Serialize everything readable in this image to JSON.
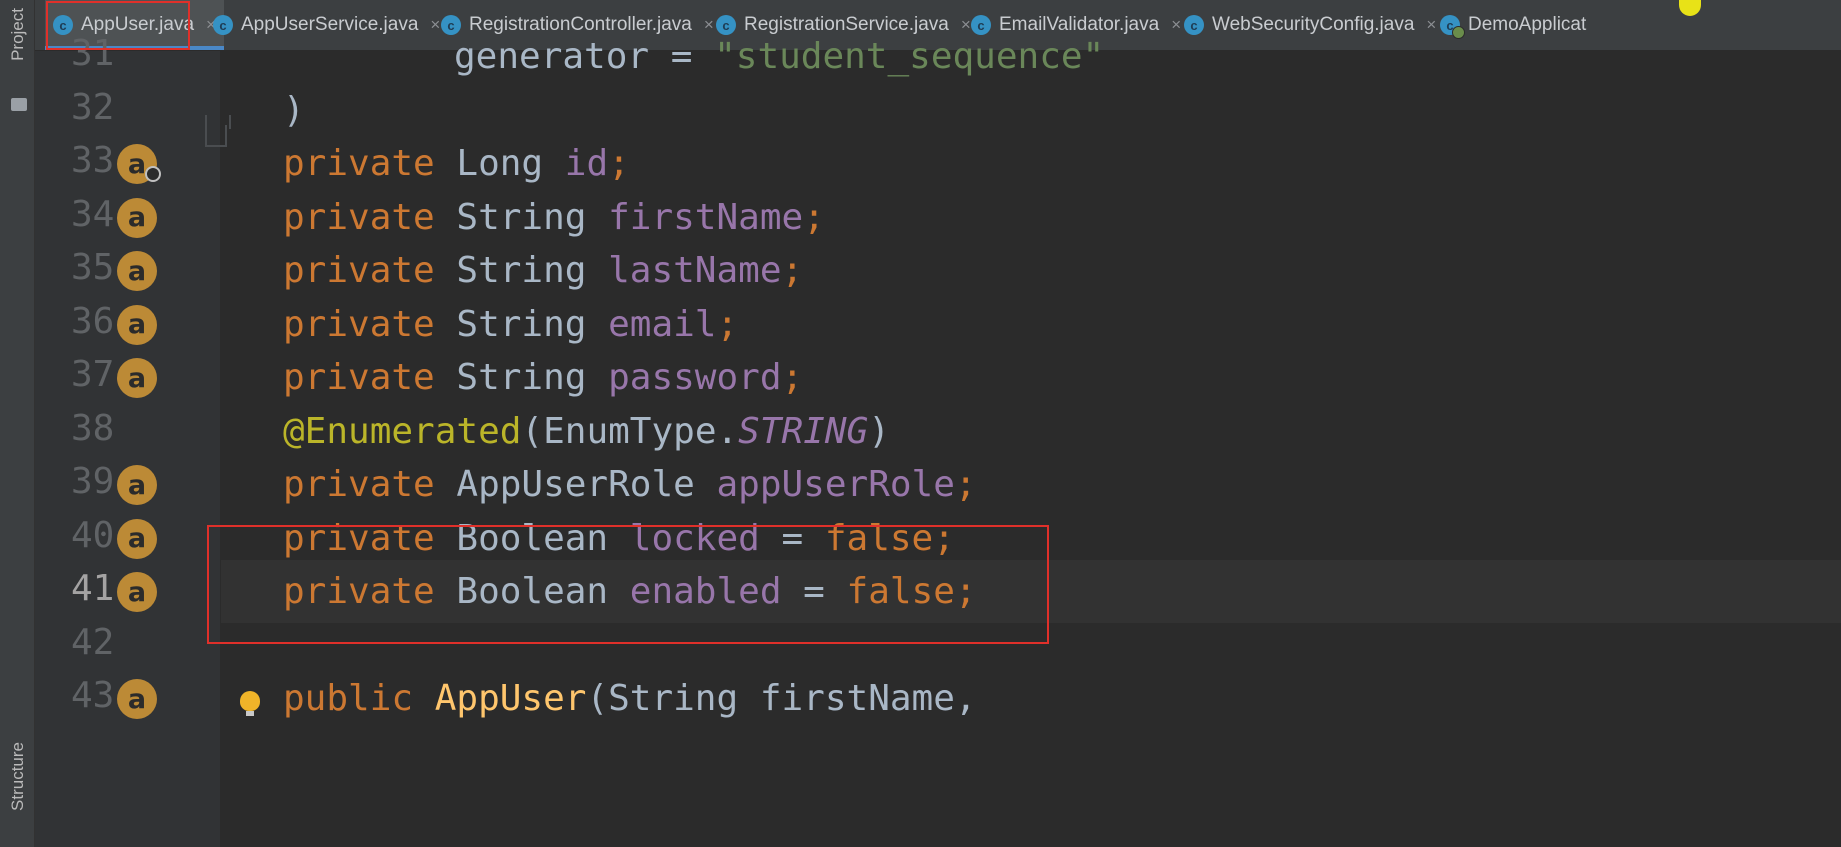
{
  "tool_windows": {
    "project_label": "Project",
    "structure_label": "Structure"
  },
  "tabs": [
    {
      "label": "AppUser.java",
      "active": true
    },
    {
      "label": "AppUserService.java",
      "active": false
    },
    {
      "label": "RegistrationController.java",
      "active": false
    },
    {
      "label": "RegistrationService.java",
      "active": false
    },
    {
      "label": "EmailValidator.java",
      "active": false
    },
    {
      "label": "WebSecurityConfig.java",
      "active": false
    },
    {
      "label": "DemoApplicat",
      "active": false
    }
  ],
  "tab_close_glyph": "×",
  "class_icon_glyph": "c",
  "field_icon_glyph": "a",
  "current_line": "41",
  "code_lines": [
    {
      "number": "31",
      "indent": "        ",
      "tokens": [
        [
          "t",
          "generator = "
        ],
        [
          "s",
          "\"student_sequence\""
        ]
      ]
    },
    {
      "number": "32",
      "indent": "",
      "tokens": [
        [
          "t",
          ")"
        ]
      ]
    },
    {
      "number": "33",
      "indent": "",
      "tokens": [
        [
          "k",
          "private "
        ],
        [
          "t",
          "Long "
        ],
        [
          "f",
          "id"
        ],
        [
          "k",
          ";"
        ]
      ]
    },
    {
      "number": "34",
      "indent": "",
      "tokens": [
        [
          "k",
          "private "
        ],
        [
          "t",
          "String "
        ],
        [
          "f",
          "firstName"
        ],
        [
          "k",
          ";"
        ]
      ]
    },
    {
      "number": "35",
      "indent": "",
      "tokens": [
        [
          "k",
          "private "
        ],
        [
          "t",
          "String "
        ],
        [
          "f",
          "lastName"
        ],
        [
          "k",
          ";"
        ]
      ]
    },
    {
      "number": "36",
      "indent": "",
      "tokens": [
        [
          "k",
          "private "
        ],
        [
          "t",
          "String "
        ],
        [
          "f",
          "email"
        ],
        [
          "k",
          ";"
        ]
      ]
    },
    {
      "number": "37",
      "indent": "",
      "tokens": [
        [
          "k",
          "private "
        ],
        [
          "t",
          "String "
        ],
        [
          "f",
          "password"
        ],
        [
          "k",
          ";"
        ]
      ]
    },
    {
      "number": "38",
      "indent": "",
      "tokens": [
        [
          "a",
          "@Enumerated"
        ],
        [
          "t",
          "(EnumType."
        ],
        [
          "c",
          "STRING"
        ],
        [
          "t",
          ")"
        ]
      ]
    },
    {
      "number": "39",
      "indent": "",
      "tokens": [
        [
          "k",
          "private "
        ],
        [
          "t",
          "AppUserRole "
        ],
        [
          "f",
          "appUserRole"
        ],
        [
          "k",
          ";"
        ]
      ]
    },
    {
      "number": "40",
      "indent": "",
      "tokens": [
        [
          "k",
          "private "
        ],
        [
          "t",
          "Boolean "
        ],
        [
          "f",
          "locked"
        ],
        [
          "t",
          " = "
        ],
        [
          "k",
          "false;"
        ]
      ]
    },
    {
      "number": "41",
      "indent": "",
      "tokens": [
        [
          "k",
          "private "
        ],
        [
          "t",
          "Boolean "
        ],
        [
          "f",
          "enabled"
        ],
        [
          "t",
          " = "
        ],
        [
          "k",
          "false;"
        ]
      ]
    },
    {
      "number": "42",
      "indent": "",
      "tokens": []
    },
    {
      "number": "43",
      "indent": "",
      "tokens": [
        [
          "k",
          "public "
        ],
        [
          "m",
          "AppUser"
        ],
        [
          "t",
          "(String firstName,"
        ]
      ]
    }
  ],
  "field_icon_lines": [
    "33",
    "34",
    "35",
    "36",
    "37",
    "39",
    "40",
    "41",
    "43"
  ],
  "key_badge_line": "33",
  "colors": {
    "editor_bg": "#2b2b2b",
    "keyword": "#cc7832",
    "field": "#9876aa",
    "string": "#6a8759",
    "annotation": "#bbb529",
    "highlight_box": "#e0302a",
    "field_icon": "#bc8a36"
  }
}
